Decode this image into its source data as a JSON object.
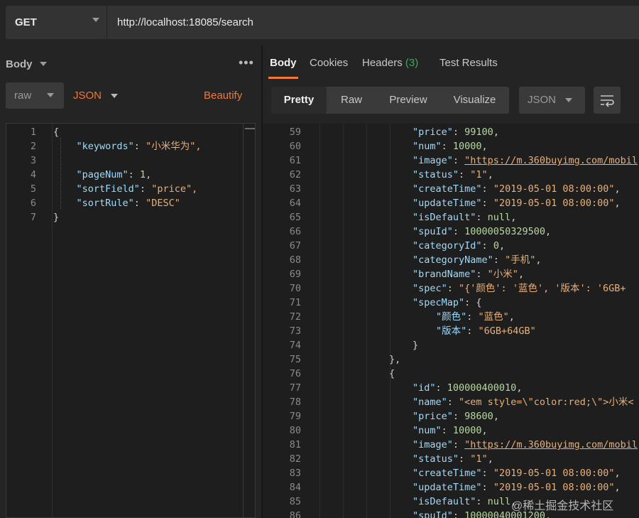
{
  "request": {
    "method": "GET",
    "url": "http://localhost:18085/search"
  },
  "left_pane": {
    "body_label": "Body",
    "more_label": "•••",
    "mode": "raw",
    "format": "JSON",
    "beautify_label": "Beautify",
    "code_lines": [
      {
        "n": "1",
        "t": "{"
      },
      {
        "n": "2",
        "t": "    \"keywords\": \"小米华为\","
      },
      {
        "n": "3",
        "t": ""
      },
      {
        "n": "4",
        "t": "    \"pageNum\": 1,"
      },
      {
        "n": "5",
        "t": "    \"sortField\": \"price\","
      },
      {
        "n": "6",
        "t": "    \"sortRule\": \"DESC\""
      },
      {
        "n": "7",
        "t": "}"
      }
    ]
  },
  "response_tabs": {
    "body": "Body",
    "cookies": "Cookies",
    "headers": "Headers",
    "headers_count": "(3)",
    "tests": "Test Results"
  },
  "view_modes": [
    "Pretty",
    "Raw",
    "Preview",
    "Visualize"
  ],
  "response_format": "JSON",
  "response_lines": [
    {
      "n": "59",
      "indent": 3,
      "key": "price",
      "val": "99100",
      "type": "num",
      "comma": true
    },
    {
      "n": "60",
      "indent": 3,
      "key": "num",
      "val": "10000",
      "type": "num",
      "comma": true
    },
    {
      "n": "61",
      "indent": 3,
      "key": "image",
      "val": "\"https://m.360buyimg.com/mobil",
      "type": "url",
      "comma": false
    },
    {
      "n": "62",
      "indent": 3,
      "key": "status",
      "val": "\"1\"",
      "type": "str",
      "comma": true
    },
    {
      "n": "63",
      "indent": 3,
      "key": "createTime",
      "val": "\"2019-05-01 08:00:00\"",
      "type": "str",
      "comma": true
    },
    {
      "n": "64",
      "indent": 3,
      "key": "updateTime",
      "val": "\"2019-05-01 08:00:00\"",
      "type": "str",
      "comma": true
    },
    {
      "n": "65",
      "indent": 3,
      "key": "isDefault",
      "val": "null",
      "type": "num",
      "comma": true
    },
    {
      "n": "66",
      "indent": 3,
      "key": "spuId",
      "val": "10000050329500",
      "type": "num",
      "comma": true
    },
    {
      "n": "67",
      "indent": 3,
      "key": "categoryId",
      "val": "0",
      "type": "num",
      "comma": true
    },
    {
      "n": "68",
      "indent": 3,
      "key": "categoryName",
      "val": "\"手机\"",
      "type": "str",
      "comma": true
    },
    {
      "n": "69",
      "indent": 3,
      "key": "brandName",
      "val": "\"小米\"",
      "type": "str",
      "comma": true
    },
    {
      "n": "70",
      "indent": 3,
      "key": "spec",
      "val": "\"{'颜色': '蓝色', '版本': '6GB+",
      "type": "str",
      "comma": false
    },
    {
      "n": "71",
      "indent": 3,
      "key": "specMap",
      "val": "{",
      "type": "punct",
      "comma": false
    },
    {
      "n": "72",
      "indent": 4,
      "key": "颜色",
      "val": "\"蓝色\"",
      "type": "str",
      "comma": true
    },
    {
      "n": "73",
      "indent": 4,
      "key": "版本",
      "val": "\"6GB+64GB\"",
      "type": "str",
      "comma": false
    },
    {
      "n": "74",
      "indent": 3,
      "key": "",
      "val": "}",
      "type": "punct",
      "comma": false
    },
    {
      "n": "75",
      "indent": 2,
      "key": "",
      "val": "},",
      "type": "punct",
      "comma": false
    },
    {
      "n": "76",
      "indent": 2,
      "key": "",
      "val": "{",
      "type": "punct",
      "comma": false
    },
    {
      "n": "77",
      "indent": 3,
      "key": "id",
      "val": "100000400010",
      "type": "num",
      "comma": true
    },
    {
      "n": "78",
      "indent": 3,
      "key": "name",
      "val": "\"<em style=\\\"color:red;\\\">小米<",
      "type": "str",
      "comma": false
    },
    {
      "n": "79",
      "indent": 3,
      "key": "price",
      "val": "98600",
      "type": "num",
      "comma": true
    },
    {
      "n": "80",
      "indent": 3,
      "key": "num",
      "val": "10000",
      "type": "num",
      "comma": true
    },
    {
      "n": "81",
      "indent": 3,
      "key": "image",
      "val": "\"https://m.360buyimg.com/mobil",
      "type": "url",
      "comma": false
    },
    {
      "n": "82",
      "indent": 3,
      "key": "status",
      "val": "\"1\"",
      "type": "str",
      "comma": true
    },
    {
      "n": "83",
      "indent": 3,
      "key": "createTime",
      "val": "\"2019-05-01 08:00:00\"",
      "type": "str",
      "comma": true
    },
    {
      "n": "84",
      "indent": 3,
      "key": "updateTime",
      "val": "\"2019-05-01 08:00:00\"",
      "type": "str",
      "comma": true
    },
    {
      "n": "85",
      "indent": 3,
      "key": "isDefault",
      "val": "null",
      "type": "num",
      "comma": true
    },
    {
      "n": "86",
      "indent": 3,
      "key": "spuId",
      "val": "10000040001200",
      "type": "num",
      "comma": true
    }
  ],
  "watermark": "@稀土掘金技术社区",
  "icons": {
    "method_caret": "chevron-down-icon",
    "more": "more-dots-icon",
    "wrap": "wrap-lines-icon"
  }
}
